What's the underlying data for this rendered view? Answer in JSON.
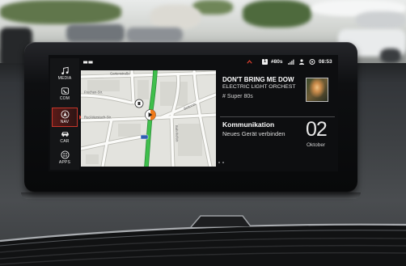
{
  "colors": {
    "accent_red": "#c8362b",
    "route_green": "#3fbf4c",
    "position_marker_orange": "#f07a1a",
    "road_sign_blue": "#2f5fb3",
    "screen_background": "#0d0e10"
  },
  "sidebar": {
    "items": [
      {
        "label": "MEDIA",
        "icon": "music-note-icon",
        "active": false
      },
      {
        "label": "COM",
        "icon": "phone-icon",
        "active": false
      },
      {
        "label": "NAV",
        "icon": "navigation-compass-icon",
        "active": true
      },
      {
        "label": "CAR",
        "icon": "car-icon",
        "active": false
      },
      {
        "label": "APPS",
        "icon": "apps-icon",
        "active": false
      }
    ]
  },
  "status_bar": {
    "left_icon": "split-screen-icon",
    "notification_icon": "chevron-up-icon",
    "preset_number": "1",
    "station": "#80s",
    "status_icons": [
      "signal-icon",
      "person-icon",
      "phone-status-icon"
    ],
    "time": "08:53"
  },
  "map": {
    "street_labels": [
      "Gartenstraße",
      "Frechen-Str.",
      "Rud-Merstach-Str.",
      "Bahnhofstr.",
      "Bettorstr."
    ],
    "markers": [
      "poi-marker-icon",
      "current-position-icon",
      "road-number-sign"
    ]
  },
  "media": {
    "title": "DON'T BRING ME DOW",
    "artist": "ELECTRIC LIGHT ORCHEST",
    "station": "# Super 80s",
    "cover_icon": "album-cover-image"
  },
  "communication": {
    "title": "Kommunikation",
    "subtitle": "Neues Gerät verbinden",
    "day": "02",
    "month": "Oktober"
  },
  "pagination": {
    "page_count": 3,
    "active_page": 1
  }
}
